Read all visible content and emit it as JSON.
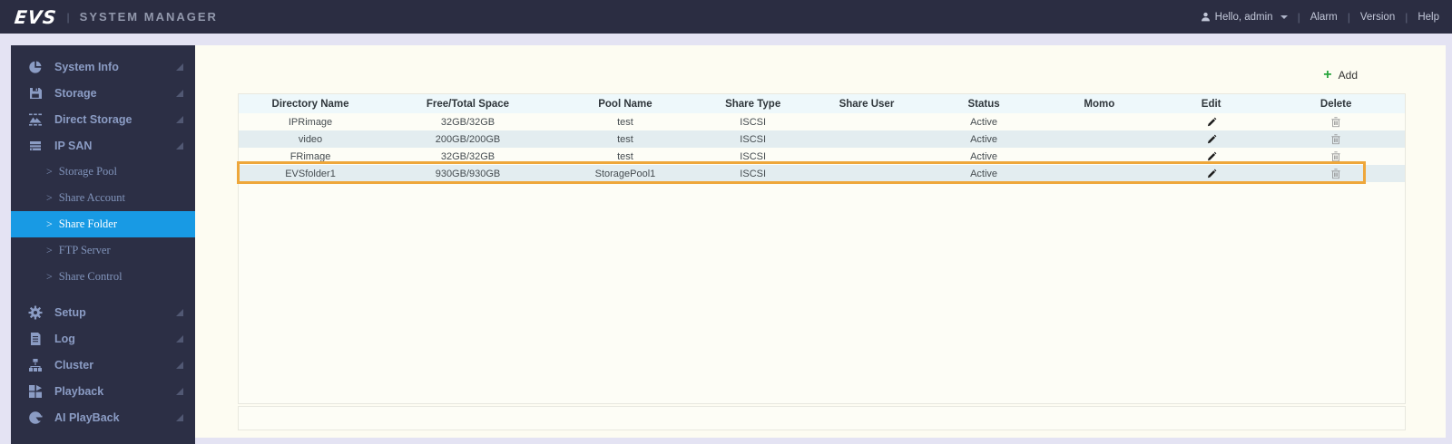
{
  "topbar": {
    "logo": "EVS",
    "divider": "|",
    "title": "SYSTEM MANAGER",
    "user": "Hello, admin",
    "user_icon": "person-icon",
    "menu": [
      "Alarm",
      "Version",
      "Help"
    ]
  },
  "sidebar": {
    "items": [
      {
        "label": "System Info",
        "icon": "pie-chart-icon",
        "collapsed": true
      },
      {
        "label": "Storage",
        "icon": "floppy-icon",
        "collapsed": true
      },
      {
        "label": "Direct Storage",
        "icon": "direct-storage-icon",
        "collapsed": true
      },
      {
        "label": "IP SAN",
        "icon": "server-icon",
        "collapsed": true,
        "expanded": true,
        "children": [
          "Storage Pool",
          "Share Account",
          "Share Folder",
          "FTP Server",
          "Share Control"
        ],
        "active_child": "Share Folder",
        "child_chevron": ">"
      },
      {
        "label": "Setup",
        "icon": "gear-icon",
        "collapsed": true
      },
      {
        "label": "Log",
        "icon": "log-icon",
        "collapsed": true
      },
      {
        "label": "Cluster",
        "icon": "cluster-icon",
        "collapsed": true
      },
      {
        "label": "Playback",
        "icon": "playback-icon",
        "collapsed": true
      },
      {
        "label": "AI PlayBack",
        "icon": "ai-playback-icon",
        "collapsed": true
      }
    ]
  },
  "main": {
    "add_button": {
      "icon": "plus-icon",
      "label": "Add"
    },
    "table": {
      "columns": [
        "Directory Name",
        "Free/Total Space",
        "Pool Name",
        "Share Type",
        "Share User",
        "Status",
        "Momo",
        "Edit",
        "Delete"
      ],
      "rows": [
        {
          "directory_name": "IPRimage",
          "free_total": "32GB/32GB",
          "pool": "test",
          "share_type": "ISCSI",
          "share_user": "",
          "status": "Active",
          "momo": "",
          "edit_icon": "pencil-icon",
          "delete_icon": "trash-icon",
          "highlighted": false
        },
        {
          "directory_name": "video",
          "free_total": "200GB/200GB",
          "pool": "test",
          "share_type": "ISCSI",
          "share_user": "",
          "status": "Active",
          "momo": "",
          "edit_icon": "pencil-icon",
          "delete_icon": "trash-icon",
          "highlighted": false
        },
        {
          "directory_name": "FRimage",
          "free_total": "32GB/32GB",
          "pool": "test",
          "share_type": "ISCSI",
          "share_user": "",
          "status": "Active",
          "momo": "",
          "edit_icon": "pencil-icon",
          "delete_icon": "trash-icon",
          "highlighted": false
        },
        {
          "directory_name": "EVSfolder1",
          "free_total": "930GB/930GB",
          "pool": "StoragePool1",
          "share_type": "ISCSI",
          "share_user": "",
          "status": "Active",
          "momo": "",
          "edit_icon": "pencil-icon",
          "delete_icon": "trash-icon",
          "highlighted": true
        }
      ]
    }
  },
  "colors": {
    "topbar_bg": "#2b2d42",
    "sidebar_bg": "#2c2f45",
    "active_nav_bg": "#189ae4",
    "page_bg": "#e4e3f3",
    "panel_bg": "#fdfcf2",
    "table_header_bg": "#eef8fb",
    "row_alt_bg": "#e3edf0",
    "highlight_border": "#eea73b",
    "add_plus_green": "#27a53d"
  }
}
